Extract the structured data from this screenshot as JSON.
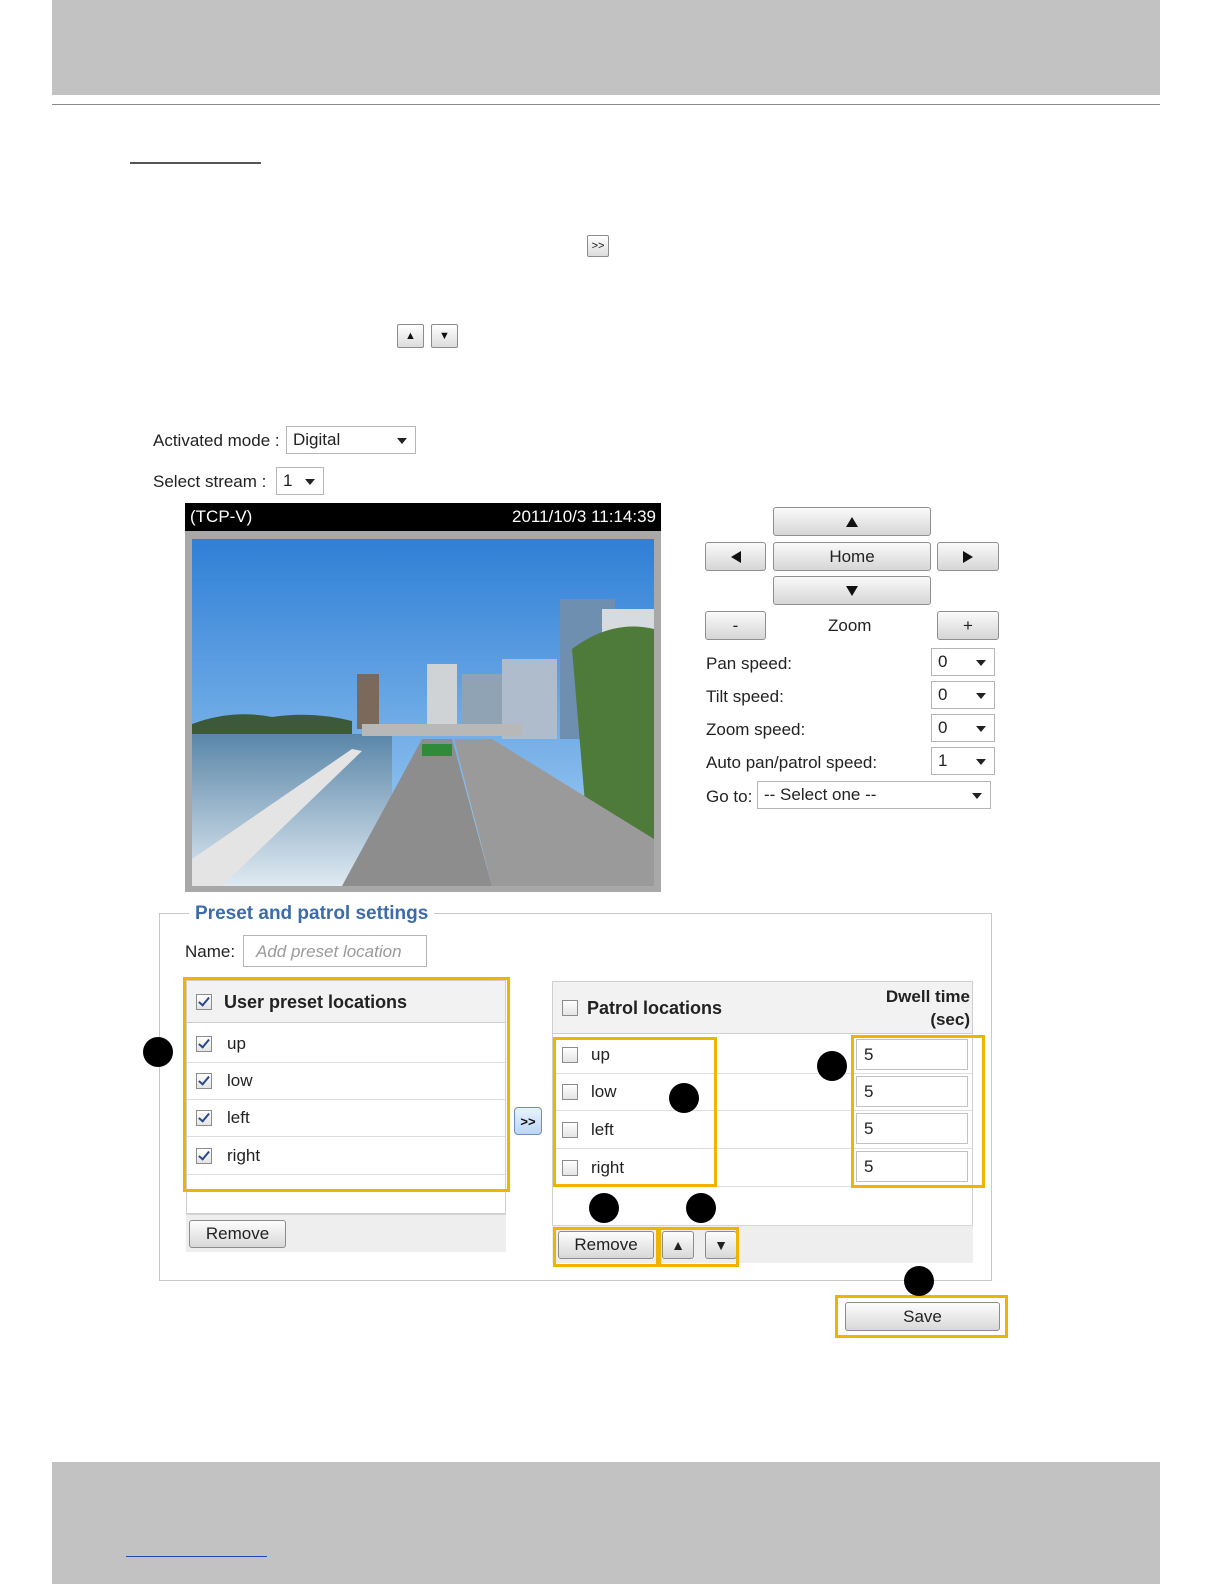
{
  "page": {
    "inline_transfer_label": ">>",
    "inline_up_label": "▲",
    "inline_down_label": "▼"
  },
  "form": {
    "activated_mode_label": "Activated mode :",
    "activated_mode_value": "Digital",
    "select_stream_label": "Select stream :",
    "select_stream_value": "1"
  },
  "video": {
    "protocol": "(TCP-V)",
    "timestamp": "2011/10/3 11:14:39"
  },
  "ptz": {
    "home_label": "Home",
    "zoom_label": "Zoom",
    "zoom_out_label": "-",
    "zoom_in_label": "+",
    "pan_speed_label": "Pan speed:",
    "pan_speed_value": "0",
    "tilt_speed_label": "Tilt speed:",
    "tilt_speed_value": "0",
    "zoom_speed_label": "Zoom speed:",
    "zoom_speed_value": "0",
    "auto_speed_label": "Auto pan/patrol speed:",
    "auto_speed_value": "1",
    "goto_label": "Go to:",
    "goto_value": "-- Select one --"
  },
  "preset": {
    "legend": "Preset and patrol settings",
    "name_label": "Name:",
    "name_placeholder": "Add preset location",
    "user_header": "User preset locations",
    "user_items": [
      {
        "label": "up",
        "checked": true
      },
      {
        "label": "low",
        "checked": true
      },
      {
        "label": "left",
        "checked": true
      },
      {
        "label": "right",
        "checked": true
      }
    ],
    "remove_label": "Remove",
    "transfer_label": ">>",
    "patrol_header": "Patrol locations",
    "dwell_header_1": "Dwell time",
    "dwell_header_2": "(sec)",
    "patrol_items": [
      {
        "label": "up",
        "dwell": "5"
      },
      {
        "label": "low",
        "dwell": "5"
      },
      {
        "label": "left",
        "dwell": "5"
      },
      {
        "label": "right",
        "dwell": "5"
      }
    ],
    "patrol_remove_label": "Remove",
    "move_up_label": "▲",
    "move_down_label": "▼",
    "save_label": "Save"
  },
  "colors": {
    "highlight": "#f0b400",
    "legend": "#3d6ca8",
    "band": "#c2c2c2"
  }
}
